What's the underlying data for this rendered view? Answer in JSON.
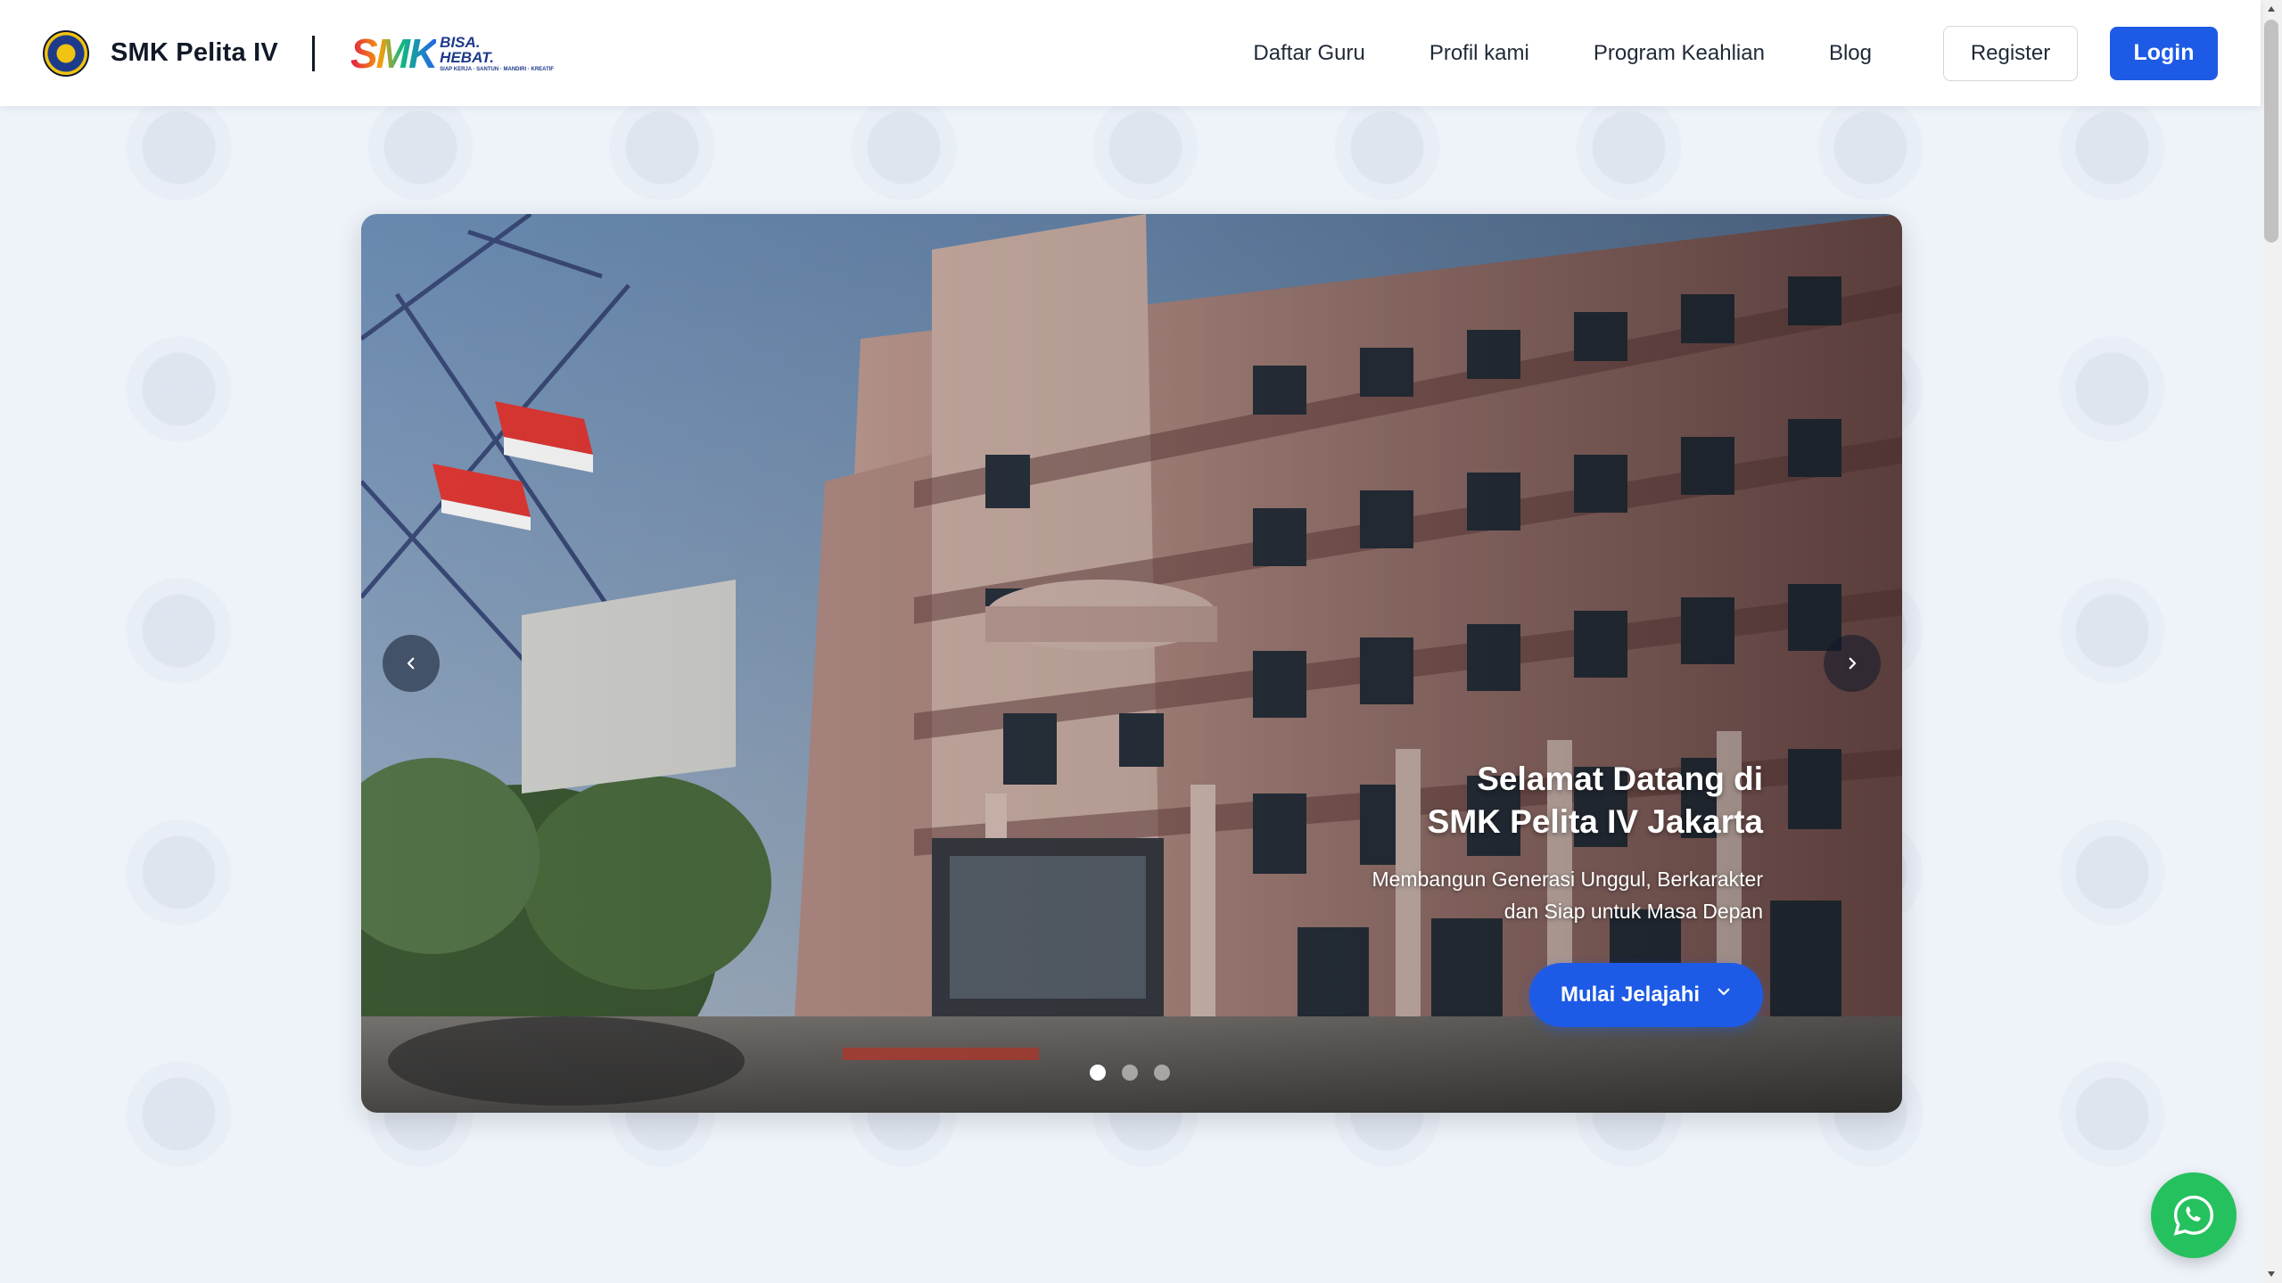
{
  "header": {
    "brand_name": "SMK Pelita IV",
    "logo": {
      "big_text": "SMK",
      "word1": "BISA.",
      "word2": "HEBAT.",
      "tagline": "SIAP KERJA · SANTUN · MANDIRI · KREATIF"
    },
    "nav": [
      {
        "label": "Daftar Guru"
      },
      {
        "label": "Profil kami"
      },
      {
        "label": "Program Keahlian"
      },
      {
        "label": "Blog"
      }
    ],
    "register_label": "Register",
    "login_label": "Login"
  },
  "hero": {
    "title_line1": "Selamat Datang di",
    "title_line2": "SMK Pelita IV Jakarta",
    "subtitle_line1": "Membangun Generasi Unggul, Berkarakter",
    "subtitle_line2": "dan Siap untuk Masa Depan",
    "cta_label": "Mulai Jelajahi",
    "slide_count": 3,
    "active_slide": 1
  },
  "colors": {
    "primary": "#1d5be6",
    "page_bg": "#eef3fa",
    "whatsapp": "#25c15e"
  },
  "icons": {
    "prev": "chevron-left-icon",
    "next": "chevron-right-icon",
    "cta": "chevron-down-icon",
    "floating": "whatsapp-icon"
  }
}
